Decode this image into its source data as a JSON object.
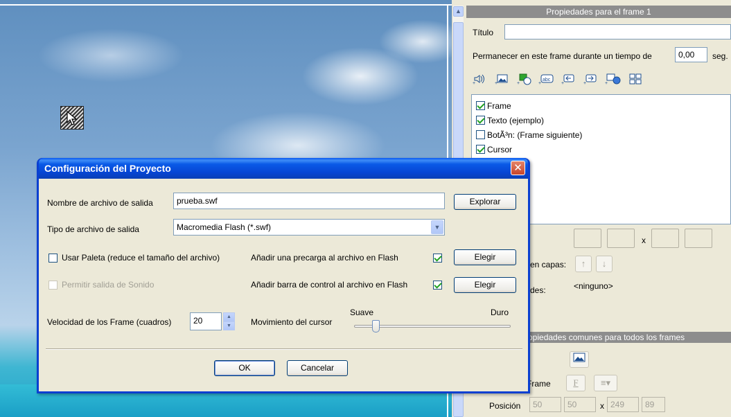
{
  "props_panel": {
    "header": "Propiedades para el frame 1",
    "title_label": "Título",
    "title_value": "",
    "stay_label": "Permanecer en este frame durante un tiempo de",
    "stay_value": "0,00",
    "stay_unit": "seg.",
    "toolbar_icons": [
      "sound-icon",
      "image-icon",
      "shape-icon",
      "text-icon",
      "button-prev-icon",
      "button-next-icon",
      "web-link-icon",
      "grid-icon"
    ],
    "frame_items": [
      {
        "label": "Frame",
        "checked": true
      },
      {
        "label": "Texto (ejemplo)",
        "checked": true
      },
      {
        "label": "BotÃ³n: (Frame siguiente)",
        "checked": false
      },
      {
        "label": "Cursor",
        "checked": true
      }
    ],
    "size_x": "x",
    "layers_label": "en capas:",
    "props_label": "des:",
    "props_value": "<ninguno>",
    "common_header": "ppiedades comunes para todos los frames",
    "frame_label": "Frame",
    "font_button": "F",
    "position_label": "Posición",
    "position": {
      "x": "50",
      "y": "50",
      "sep": "x",
      "w": "249",
      "h": "89"
    }
  },
  "dialog": {
    "title": "Configuración del Proyecto",
    "close_glyph": "✕",
    "output_name_label": "Nombre de archivo de salida",
    "output_name_value": "prueba.swf",
    "browse_label": "Explorar",
    "output_type_label": "Tipo de archivo de salida",
    "output_type_value": "Macromedia Flash (*.swf)",
    "use_palette_label": "Usar Paleta (reduce el tamaño del archivo)",
    "use_palette_checked": false,
    "preload_label": "Añadir una precarga al archivo en Flash",
    "preload_checked": true,
    "choose_label": "Elegir",
    "sound_label": "Permitir salida de Sonido",
    "sound_checked": false,
    "controlbar_label": "Añadir barra de control al archivo en Flash",
    "controlbar_checked": true,
    "choose2_label": "Elegir",
    "speed_label": "Velocidad de los Frame (cuadros)",
    "speed_value": "20",
    "cursor_move_label": "Movimiento del cursor",
    "slider_min_label": "Suave",
    "slider_max_label": "Duro",
    "slider_value": 0.12,
    "ok_label": "OK",
    "cancel_label": "Cancelar"
  },
  "colors": {
    "dialog_frame": "#0a3fd1",
    "panel_header": "#8d8d8d",
    "checkmark": "#21a121"
  }
}
